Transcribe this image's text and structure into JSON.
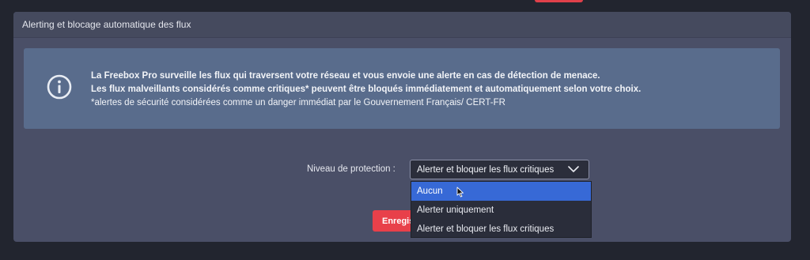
{
  "panel": {
    "title": "Alerting et blocage automatique des flux"
  },
  "info": {
    "icon": "info-circle-icon",
    "line1": "La Freebox Pro surveille les flux qui traversent votre réseau et vous envoie une alerte en cas de détection de menace.",
    "line2": "Les flux malveillants considérés comme critiques* peuvent être bloqués immédiatement et automatiquement selon votre choix.",
    "line3": "*alertes de sécurité considérées comme un danger immédiat par le Gouvernement Français/ CERT-FR"
  },
  "protection": {
    "label": "Niveau de protection :",
    "selected": "Alerter et bloquer les flux critiques",
    "options": [
      "Aucun",
      "Alerter uniquement",
      "Alerter et bloquer les flux critiques"
    ],
    "highlighted_index": 0
  },
  "save_button": {
    "label": "Enregistrer"
  },
  "colors": {
    "accent_red": "#e8404a",
    "highlight_blue": "#3769d6",
    "panel_bg": "#4a4f67",
    "info_bg": "#596c8c"
  }
}
